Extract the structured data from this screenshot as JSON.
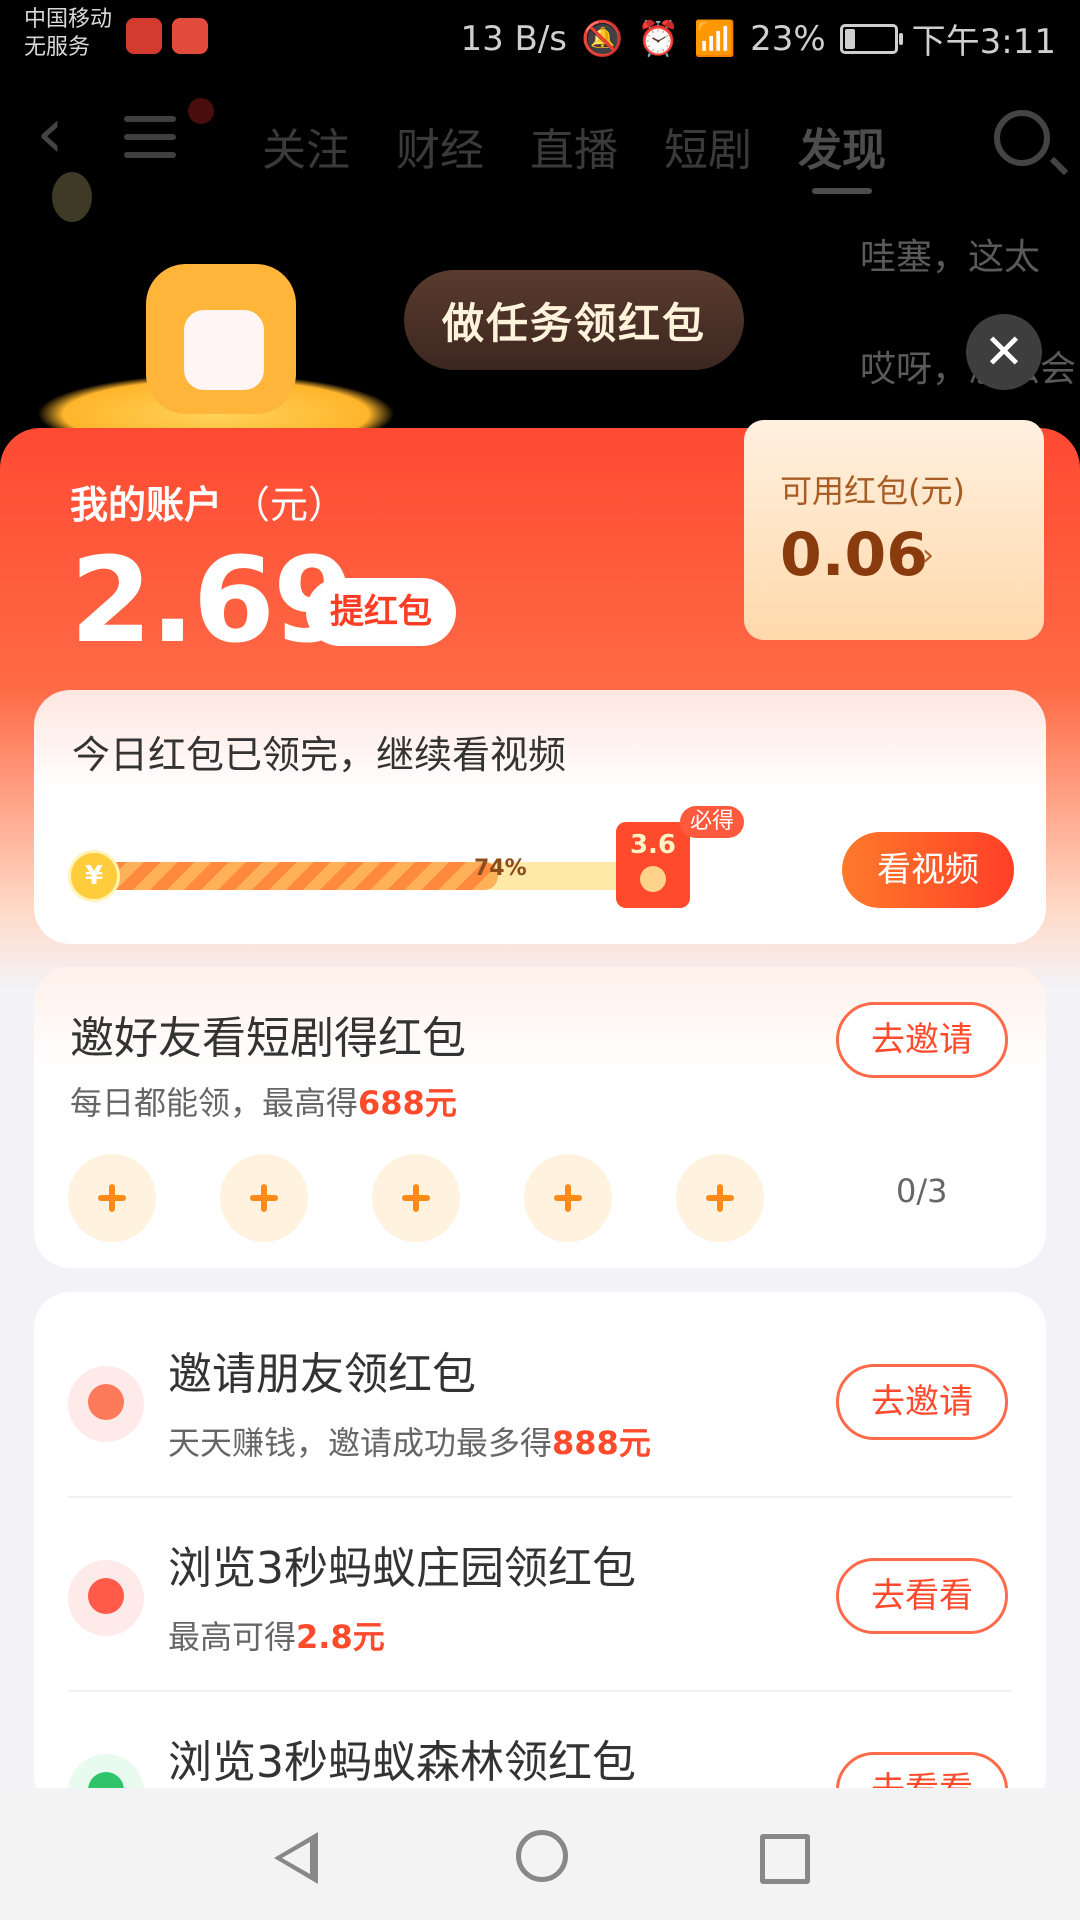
{
  "status_bar": {
    "carrier_line1": "中国移动",
    "carrier_line2": "无服务",
    "speed": "13 B/s",
    "battery": "23%",
    "time": "下午3:11"
  },
  "top_nav": {
    "tabs": [
      "关注",
      "财经",
      "直播",
      "短剧",
      "发现"
    ],
    "active_tab": "发现",
    "bg_text_1": "哇塞，这太",
    "bg_text_2": "哎呀，怎么会"
  },
  "popup": {
    "bubble_text": "做任务领红包",
    "account_title": "我的账户",
    "account_unit": "（元）",
    "balance": "2.69",
    "withdraw_label": "提红包",
    "available_label": "可用红包(元)",
    "available_value": "0.06",
    "daily": {
      "title": "今日红包已领完，继续看视频",
      "progress_percent": 74,
      "progress_label": "74%",
      "redpack_value": "3.6",
      "must_get": "必得",
      "watch_button": "看视频"
    },
    "invite_drama": {
      "title": "邀好友看短剧得红包",
      "sub_prefix": "每日都能领，最高得",
      "sub_highlight": "688元",
      "button": "去邀请",
      "count": "0/3"
    },
    "tasks": [
      {
        "title": "邀请朋友领红包",
        "sub_prefix": "天天赚钱，邀请成功最多得",
        "sub_highlight": "888元",
        "button": "去邀请"
      },
      {
        "title": "浏览3秒蚂蚁庄园领红包",
        "sub_prefix": "最高可得",
        "sub_highlight": "2.8元",
        "button": "去看看"
      },
      {
        "title": "浏览3秒蚂蚁森林领红包",
        "sub_prefix": "",
        "sub_highlight": "",
        "button": "去看看"
      }
    ]
  },
  "colors": {
    "accent": "#ff4a2c",
    "panel_top": "#ff4a33",
    "card_bg": "#ffffff"
  }
}
